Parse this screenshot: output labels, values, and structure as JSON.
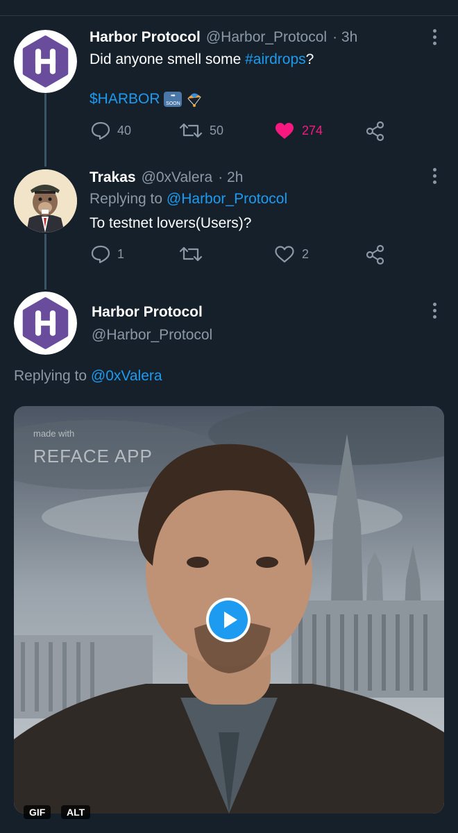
{
  "tweets": [
    {
      "name": "Harbor Protocol",
      "handle": "@Harbor_Protocol",
      "time": "· 3h",
      "text_prefix": "Did anyone smell some ",
      "hashtag": "#airdrops",
      "text_suffix": "?",
      "cashtag": "$HARBOR",
      "emoji_soon": "SOON",
      "replies": "40",
      "retweets": "50",
      "likes": "274",
      "liked": true
    },
    {
      "name": "Trakas",
      "handle": "@0xValera",
      "time": "· 2h",
      "replying_label": "Replying to",
      "replying_to": "@Harbor_Protocol",
      "text": "To testnet lovers(Users)?",
      "replies": "1",
      "retweets": "",
      "likes": "2"
    }
  ],
  "main_tweet": {
    "name": "Harbor Protocol",
    "handle": "@Harbor_Protocol",
    "replying_label": "Replying to",
    "replying_to": "@0xValera",
    "media": {
      "watermark_small": "made with",
      "watermark_large": "REFACE APP",
      "badges": [
        "GIF",
        "ALT"
      ]
    }
  },
  "colors": {
    "background": "#15202b",
    "link": "#1d9bf0",
    "like": "#f91880",
    "muted": "#8b98a5",
    "logo_purple": "#6a4c9c"
  },
  "icons": {
    "reply": "reply-icon",
    "retweet": "retweet-icon",
    "like": "heart-icon",
    "share": "share-icon",
    "more": "more-icon",
    "play": "play-icon"
  }
}
